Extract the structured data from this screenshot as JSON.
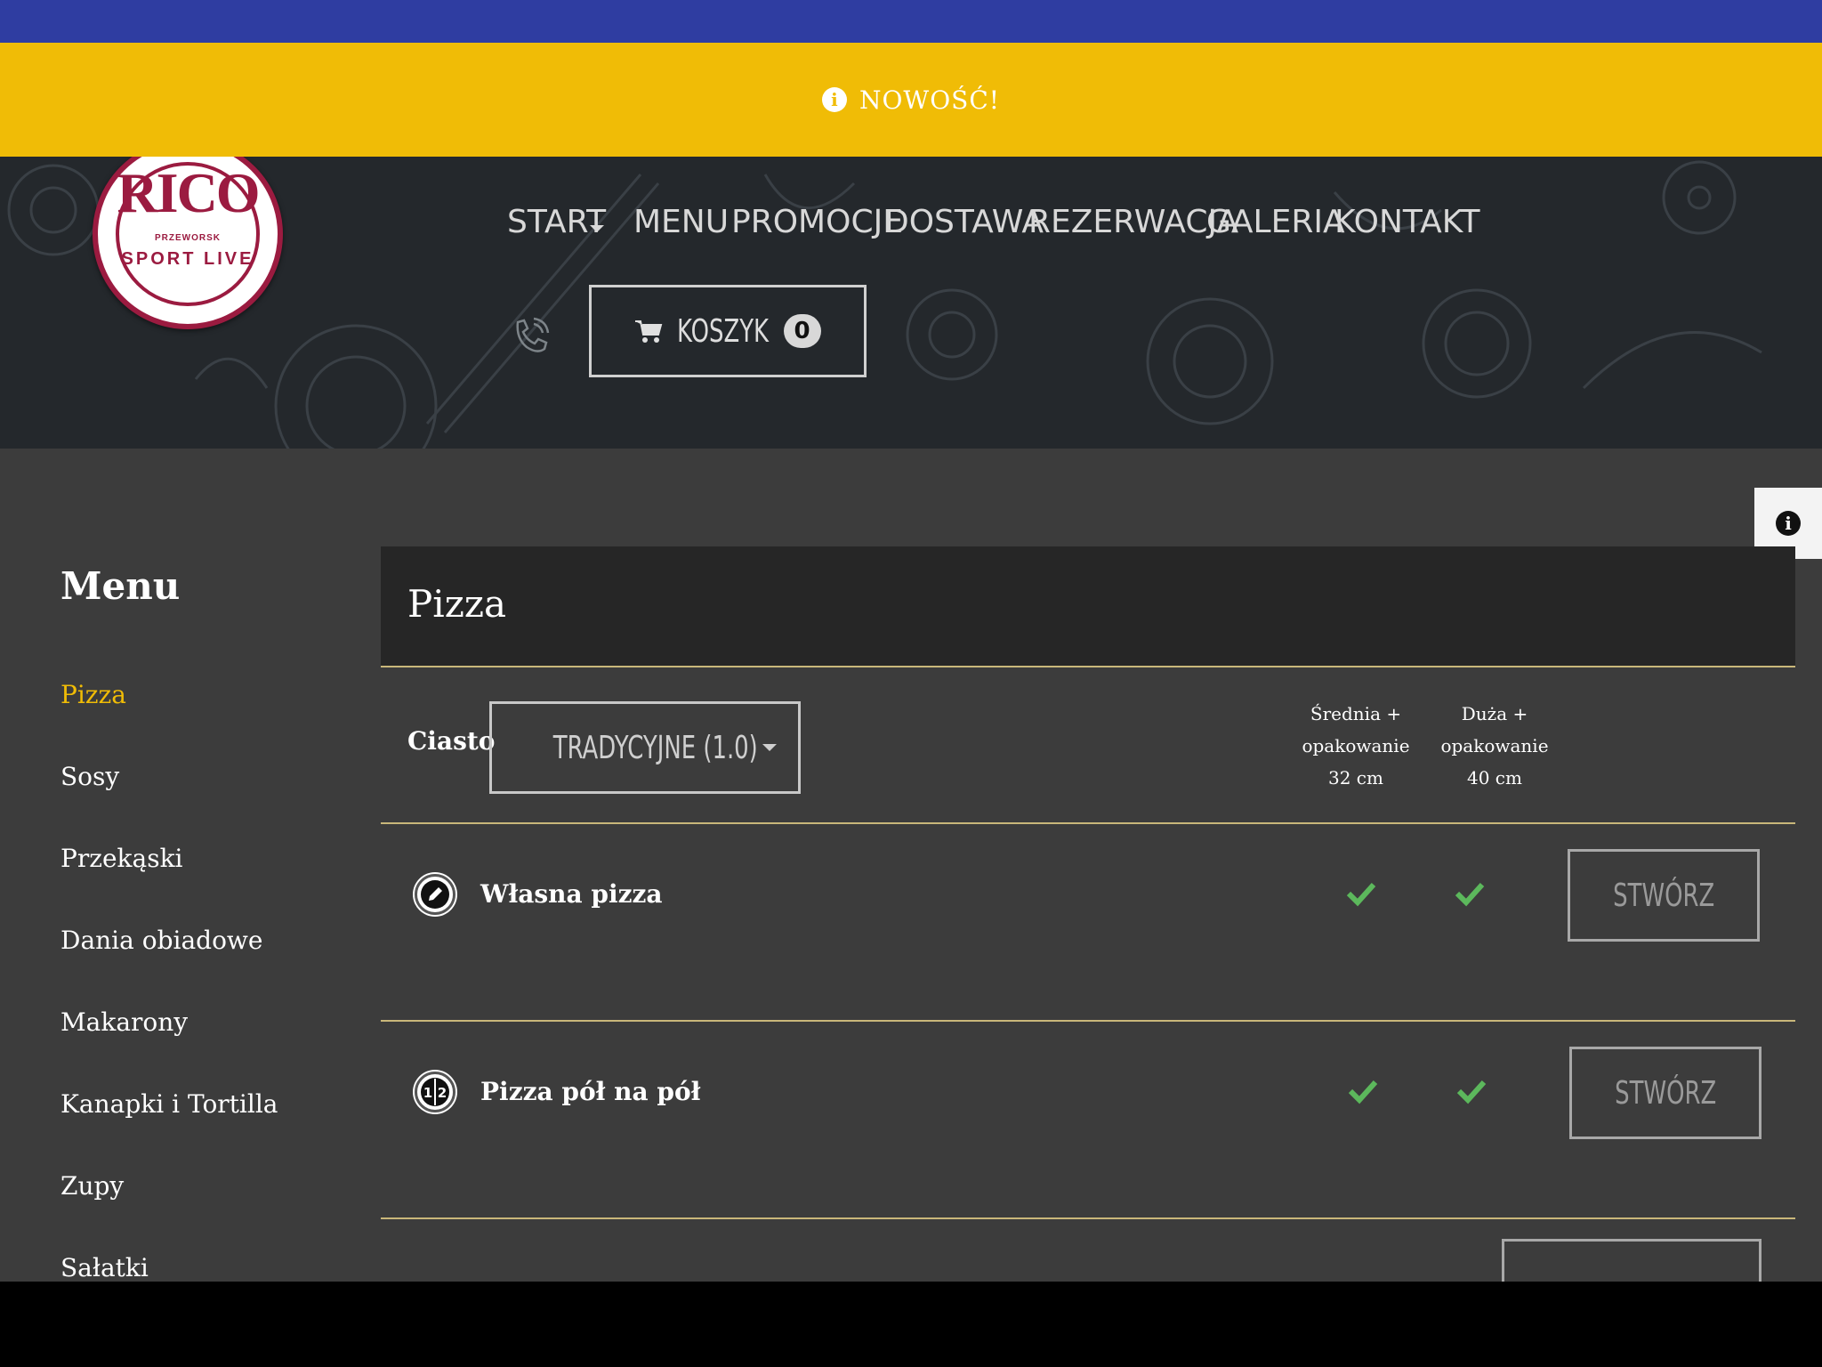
{
  "notice": {
    "text": "NOWOŚĆ!",
    "icon": "info-icon"
  },
  "logo": {
    "name": "RICO",
    "subtitle": "PRZEWORSK",
    "tagline": "SPORT LIVE"
  },
  "nav": [
    {
      "label": "START",
      "has_dropdown": true
    },
    {
      "label": "MENU"
    },
    {
      "label": "PROMOCJE"
    },
    {
      "label": "DOSTAWA"
    },
    {
      "label": "REZERWACJA"
    },
    {
      "label": "GALERIA"
    },
    {
      "label": "KONTAKT"
    }
  ],
  "cart": {
    "label": "KOSZYK",
    "count": "0",
    "icon": "cart-icon"
  },
  "sidebar": {
    "title": "Menu",
    "items": [
      {
        "label": "Pizza",
        "active": true
      },
      {
        "label": "Sosy"
      },
      {
        "label": "Przekąski"
      },
      {
        "label": "Dania obiadowe"
      },
      {
        "label": "Makarony"
      },
      {
        "label": "Kanapki i Tortilla"
      },
      {
        "label": "Zupy"
      },
      {
        "label": "Sałatki"
      }
    ]
  },
  "panel": {
    "title": "Pizza",
    "dough_label": "Ciasto",
    "dough_selected": "TRADYCYJNE (1.0)",
    "sizes": [
      {
        "line1": "Średnia +",
        "line2": "opakowanie",
        "line3": "32 cm"
      },
      {
        "line1": "Duża +",
        "line2": "opakowanie",
        "line3": "40 cm"
      }
    ],
    "rows": [
      {
        "name": "Własna pizza",
        "icon": "pencil-icon",
        "button": "STWÓRZ"
      },
      {
        "name": "Pizza pół na pół",
        "icon": "half-half-icon",
        "button": "STWÓRZ"
      }
    ]
  },
  "colors": {
    "accent": "#f0bc06",
    "top_strip": "#2f3da1",
    "check": "#5cb85c"
  }
}
